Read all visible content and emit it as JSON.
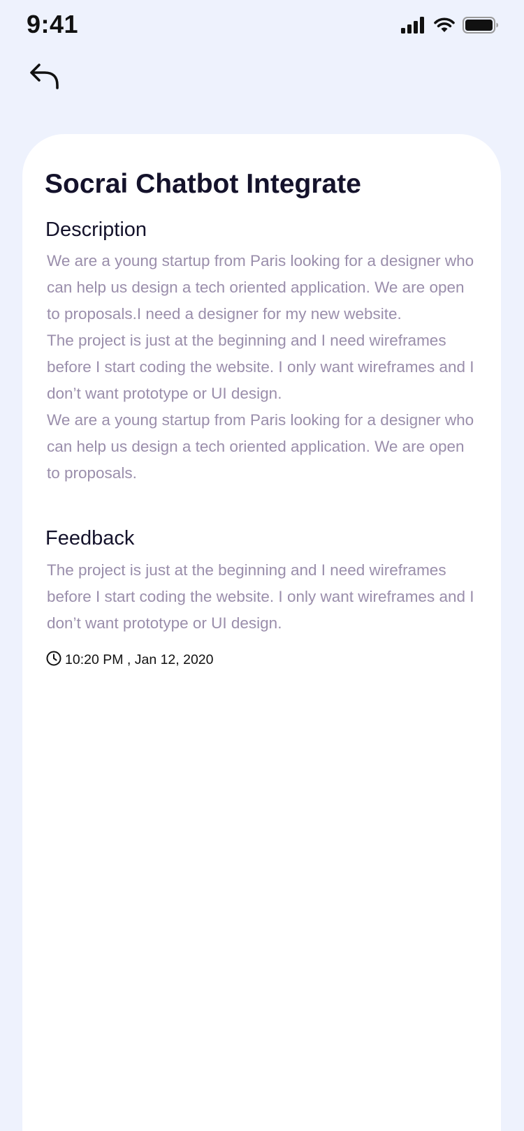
{
  "status_bar": {
    "time": "9:41"
  },
  "icons": {
    "back": "reply-arrow-icon",
    "signal": "signal-icon",
    "wifi": "wifi-icon",
    "battery": "battery-icon",
    "clock": "clock-icon"
  },
  "colors": {
    "background": "#eef2fd",
    "card": "#ffffff",
    "heading": "#14122b",
    "body_text": "#9a8eab"
  },
  "card": {
    "title": "Socrai Chatbot Integrate",
    "description": {
      "heading": "Description",
      "paragraphs": [
        "We are a young startup from Paris looking for a designer who can help us design a tech oriented application. We are open to proposals.I need a designer for my new website.",
        "The project is just at the beginning and I need wireframes before I start coding the website. I only want wireframes and I don’t want prototype or UI design.",
        "We are a young startup from Paris looking for a designer who can help us design a tech oriented application. We are open to proposals."
      ]
    },
    "feedback": {
      "heading": "Feedback",
      "text": "The project is just at the beginning and I need wireframes before I start coding the website. I only want wireframes and I don’t want prototype or UI design."
    },
    "timestamp": "10:20 PM , Jan 12, 2020"
  }
}
